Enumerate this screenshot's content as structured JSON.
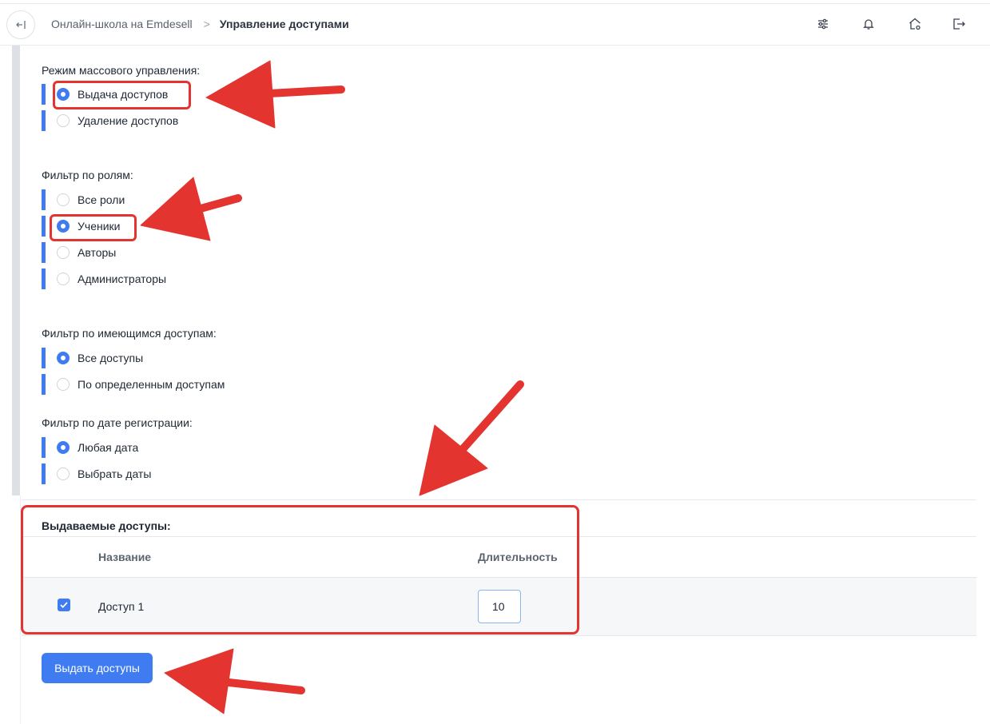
{
  "header": {
    "breadcrumb_root": "Онлайн-школа на Emdesell",
    "breadcrumb_separator": ">",
    "breadcrumb_current": "Управление доступами",
    "icons": [
      "collapse-sidebar-icon",
      "sliders-icon",
      "bell-icon",
      "home-settings-icon",
      "logout-icon"
    ]
  },
  "mode": {
    "title": "Режим массового управления:",
    "options": [
      {
        "label": "Выдача доступов",
        "checked": true
      },
      {
        "label": "Удаление доступов",
        "checked": false
      }
    ]
  },
  "roles": {
    "title": "Фильтр по ролям:",
    "options": [
      {
        "label": "Все роли",
        "checked": false
      },
      {
        "label": "Ученики",
        "checked": true
      },
      {
        "label": "Авторы",
        "checked": false
      },
      {
        "label": "Администраторы",
        "checked": false
      }
    ]
  },
  "existing_access": {
    "title": "Фильтр по имеющимся доступам:",
    "options": [
      {
        "label": "Все доступы",
        "checked": true
      },
      {
        "label": "По определенным доступам",
        "checked": false
      }
    ]
  },
  "reg_date": {
    "title": "Фильтр по дате регистрации:",
    "options": [
      {
        "label": "Любая дата",
        "checked": true
      },
      {
        "label": "Выбрать даты",
        "checked": false
      }
    ]
  },
  "granted": {
    "title": "Выдаваемые доступы:",
    "col_name": "Название",
    "col_duration": "Длительность",
    "rows": [
      {
        "checked": true,
        "name": "Доступ 1",
        "duration": "10"
      }
    ]
  },
  "submit_label": "Выдать доступы",
  "colors": {
    "accent": "#3f7bf1",
    "annotation": "#e3342f"
  }
}
